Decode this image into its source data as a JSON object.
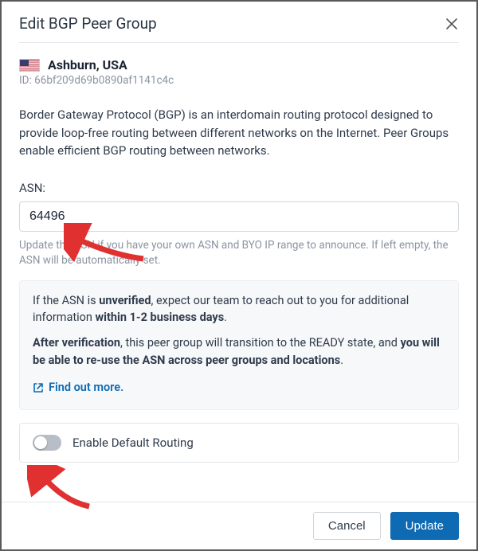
{
  "header": {
    "title": "Edit BGP Peer Group"
  },
  "location": {
    "name": "Ashburn, USA",
    "id_label": "ID: 66bf209d69b0890af1141c4c"
  },
  "description": "Border Gateway Protocol (BGP) is an interdomain routing protocol designed to provide loop-free routing between different networks on the Internet. Peer Groups enable efficient BGP routing between networks.",
  "asn": {
    "label": "ASN:",
    "value": "64496",
    "helper": "Update the ASN if you have your own ASN and BYO IP range to announce. If left empty, the ASN will be automatically set."
  },
  "info": {
    "p1_a": "If the ASN is ",
    "p1_b": "unverified",
    "p1_c": ", expect our team to reach out to you for additional information ",
    "p1_d": "within 1-2 business days",
    "p1_e": ".",
    "p2_a": "After verification",
    "p2_b": ", this peer group will transition to the READY state, and ",
    "p2_c": "you will be able to re-use the ASN across peer groups and locations",
    "p2_d": ".",
    "link": "Find out more."
  },
  "toggle": {
    "label": "Enable Default Routing"
  },
  "footer": {
    "cancel": "Cancel",
    "update": "Update"
  }
}
